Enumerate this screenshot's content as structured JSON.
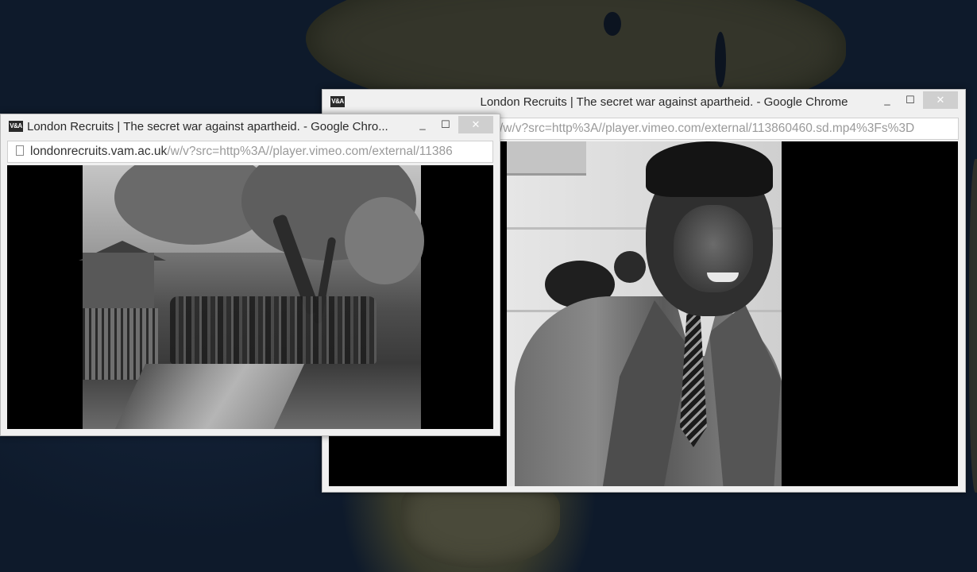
{
  "desktop": {
    "wallpaper": "satellite-map-africa"
  },
  "window_back": {
    "title": "London Recruits | The secret war against apartheid. - Google Chrome",
    "icon_label": "V&A",
    "address_path": "/w/v?src=http%3A//player.vimeo.com/external/113860460.sd.mp4%3Fs%3D",
    "controls": {
      "minimize": "_",
      "maximize": "☐",
      "close": "✕"
    }
  },
  "window_front": {
    "title": "London Recruits | The secret war against apartheid. - Google Chro...",
    "icon_label": "V&A",
    "address_host": "londonrecruits.vam.ac.uk",
    "address_path": "/w/v?src=http%3A//player.vimeo.com/external/11386",
    "controls": {
      "minimize": "_",
      "maximize": "☐",
      "close": "✕"
    }
  }
}
